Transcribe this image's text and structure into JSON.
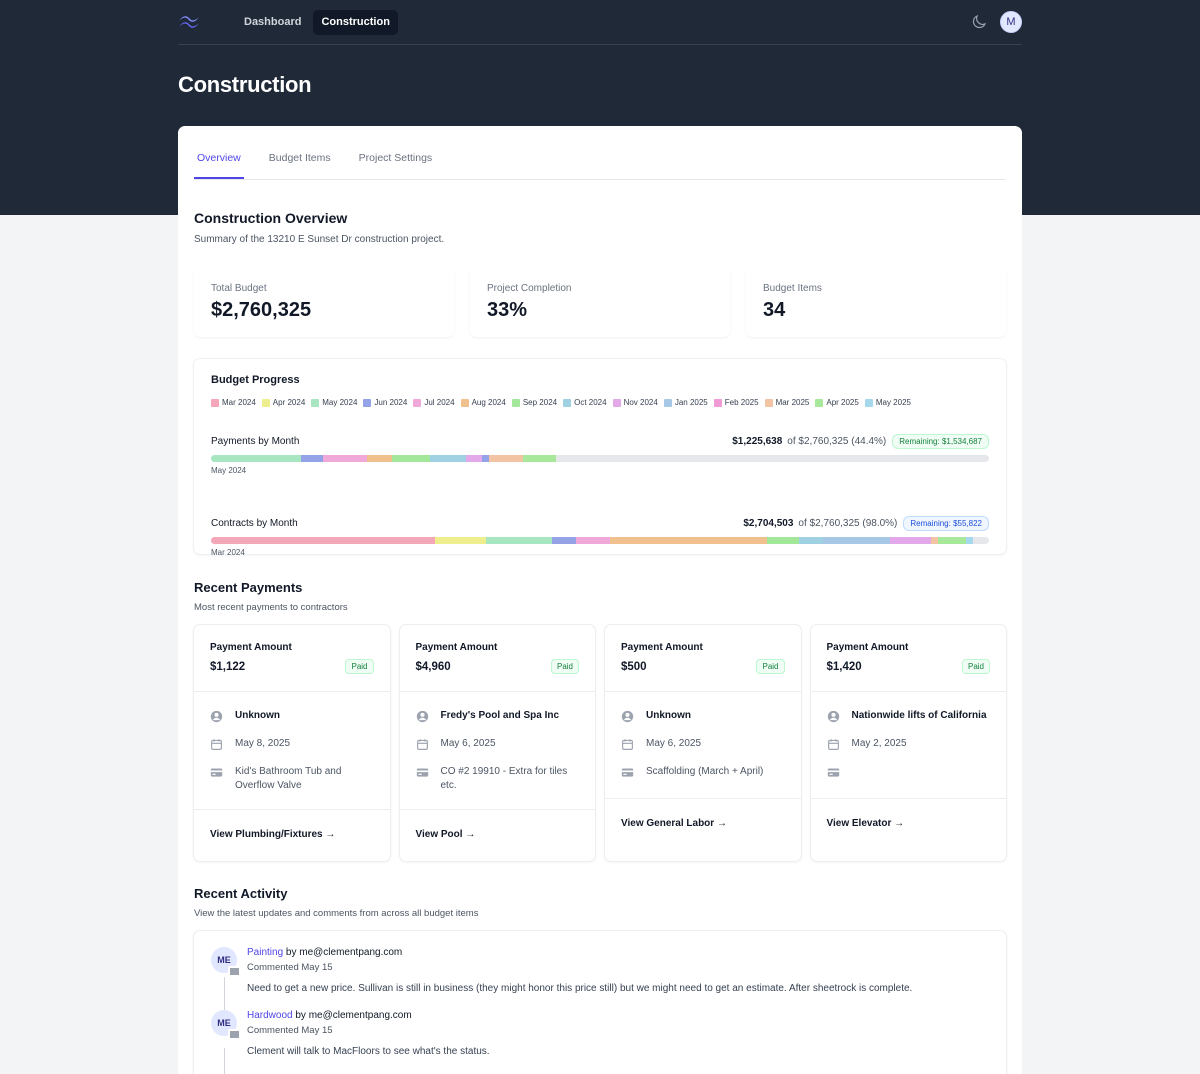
{
  "nav": {
    "links": [
      {
        "label": "Dashboard",
        "active": false
      },
      {
        "label": "Construction",
        "active": true
      }
    ],
    "avatar_initial": "M"
  },
  "page_title": "Construction",
  "tabs": [
    {
      "label": "Overview",
      "active": true
    },
    {
      "label": "Budget Items",
      "active": false
    },
    {
      "label": "Project Settings",
      "active": false
    }
  ],
  "overview": {
    "title": "Construction Overview",
    "subtitle": "Summary of the 13210 E Sunset Dr construction project."
  },
  "stats": [
    {
      "label": "Total Budget",
      "value": "$2,760,325"
    },
    {
      "label": "Project Completion",
      "value": "33%"
    },
    {
      "label": "Budget Items",
      "value": "34"
    }
  ],
  "budget_progress": {
    "title": "Budget Progress",
    "legend": [
      {
        "label": "Mar 2024",
        "color": "#f4a7b9"
      },
      {
        "label": "Apr 2024",
        "color": "#eeee8e"
      },
      {
        "label": "May 2024",
        "color": "#a8e6c1"
      },
      {
        "label": "Jun 2024",
        "color": "#94a3e8"
      },
      {
        "label": "Jul 2024",
        "color": "#f0a8d8"
      },
      {
        "label": "Aug 2024",
        "color": "#f1c08f"
      },
      {
        "label": "Sep 2024",
        "color": "#a3e89a"
      },
      {
        "label": "Oct 2024",
        "color": "#9fd1e3"
      },
      {
        "label": "Nov 2024",
        "color": "#e3a8ea"
      },
      {
        "label": "Jan 2025",
        "color": "#a6c8e6"
      },
      {
        "label": "Feb 2025",
        "color": "#f09ad6"
      },
      {
        "label": "Mar 2025",
        "color": "#f2c4a4"
      },
      {
        "label": "Apr 2025",
        "color": "#a8e89a"
      },
      {
        "label": "May 2025",
        "color": "#a4d8ea"
      }
    ],
    "payments": {
      "label": "Payments by Month",
      "amount": "$1,225,638",
      "of_text": "of $2,760,325 (44.4%)",
      "remaining": "Remaining: $1,534,687",
      "caption": "May 2024",
      "segments": [
        {
          "color": "#a8e6c1",
          "pct": 11.6
        },
        {
          "color": "#94a3e8",
          "pct": 2.8
        },
        {
          "color": "#f0a8d8",
          "pct": 5.6
        },
        {
          "color": "#f1c08f",
          "pct": 3.3
        },
        {
          "color": "#a3e89a",
          "pct": 4.9
        },
        {
          "color": "#9fd1e3",
          "pct": 4.6
        },
        {
          "color": "#e3a8ea",
          "pct": 2.0
        },
        {
          "color": "#94a3e8",
          "pct": 0.9
        },
        {
          "color": "#f2c4a4",
          "pct": 4.4
        },
        {
          "color": "#a8e89a",
          "pct": 4.3
        }
      ]
    },
    "contracts": {
      "label": "Contracts by Month",
      "amount": "$2,704,503",
      "of_text": "of $2,760,325 (98.0%)",
      "remaining": "Remaining: $55,822",
      "caption": "Mar 2024",
      "segments": [
        {
          "color": "#f4a7b9",
          "pct": 28.8
        },
        {
          "color": "#eeee8e",
          "pct": 6.5
        },
        {
          "color": "#a8e6c1",
          "pct": 8.5
        },
        {
          "color": "#94a3e8",
          "pct": 3.1
        },
        {
          "color": "#f0a8d8",
          "pct": 4.4
        },
        {
          "color": "#f1c08f",
          "pct": 20.2
        },
        {
          "color": "#a3e89a",
          "pct": 4.1
        },
        {
          "color": "#9fd1e3",
          "pct": 3.1
        },
        {
          "color": "#a6c8e6",
          "pct": 8.6
        },
        {
          "color": "#e3a8ea",
          "pct": 5.3
        },
        {
          "color": "#f2c4a4",
          "pct": 0.9
        },
        {
          "color": "#a8e89a",
          "pct": 3.5
        },
        {
          "color": "#a4d8ea",
          "pct": 1.0
        }
      ]
    }
  },
  "recent_payments": {
    "title": "Recent Payments",
    "subtitle": "Most recent payments to contractors",
    "items": [
      {
        "label": "Payment Amount",
        "amount": "$1,122",
        "status": "Paid",
        "contractor": "Unknown",
        "date": "May 8, 2025",
        "description": "Kid's Bathroom Tub and Overflow Valve",
        "link": "View Plumbing/Fixtures →"
      },
      {
        "label": "Payment Amount",
        "amount": "$4,960",
        "status": "Paid",
        "contractor": "Fredy's Pool and Spa Inc",
        "date": "May 6, 2025",
        "description": "CO #2 19910 - Extra for tiles etc.",
        "link": "View Pool →"
      },
      {
        "label": "Payment Amount",
        "amount": "$500",
        "status": "Paid",
        "contractor": "Unknown",
        "date": "May 6, 2025",
        "description": "Scaffolding (March + April)",
        "link": "View General Labor →"
      },
      {
        "label": "Payment Amount",
        "amount": "$1,420",
        "status": "Paid",
        "contractor": "Nationwide lifts of California",
        "date": "May 2, 2025",
        "description": "",
        "link": "View Elevator →"
      }
    ]
  },
  "recent_activity": {
    "title": "Recent Activity",
    "subtitle": "View the latest updates and comments from across all budget items",
    "items": [
      {
        "initials": "ME",
        "item": "Painting",
        "by": "by me@clementpang.com",
        "meta": "Commented May 15",
        "text": "Need to get a new price. Sullivan is still in business (they might honor this price still) but we might need to get an estimate. After sheetrock is complete."
      },
      {
        "initials": "ME",
        "item": "Hardwood",
        "by": "by me@clementpang.com",
        "meta": "Commented May 15",
        "text": "Clement will talk to MacFloors to see what's the status."
      }
    ]
  }
}
